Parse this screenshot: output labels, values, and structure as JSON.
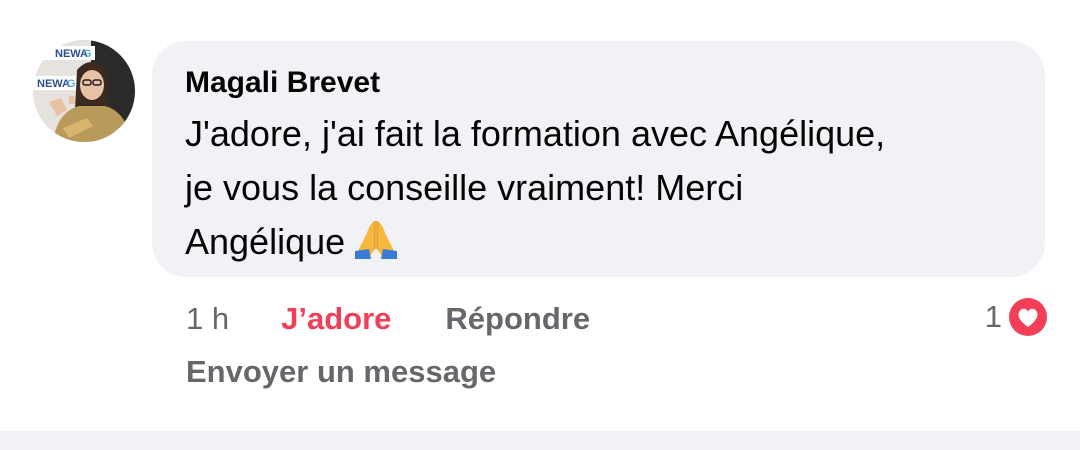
{
  "comment": {
    "author": "Magali Brevet",
    "text_lines": [
      "J'adore, j'ai fait la formation avec Angélique,",
      "je vous la conseille vraiment! Merci",
      "Angélique"
    ],
    "emoji": "folded-hands-emoji",
    "avatar_logo_text": "NEWAG"
  },
  "actions": {
    "time": "1 h",
    "reaction_label": "J’adore",
    "reply_label": "Répondre",
    "message_label": "Envoyer un message"
  },
  "reactions": {
    "count": "1",
    "icon": "heart-reaction-icon"
  },
  "colors": {
    "bubble": "#f0f2f5",
    "love": "#f33e58",
    "secondary_text": "#65676b",
    "primary_text": "#050505"
  }
}
